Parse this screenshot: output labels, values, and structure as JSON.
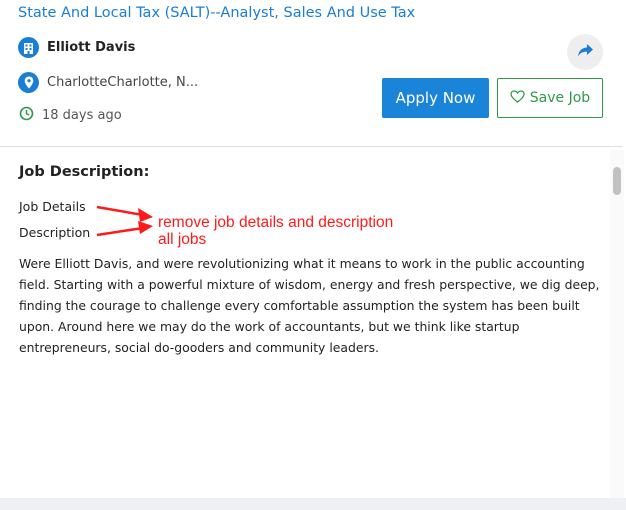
{
  "job": {
    "title": "State And Local Tax (SALT)--Analyst, Sales And Use Tax",
    "company": "Elliott Davis",
    "location": "CharlotteCharlotte, N...",
    "posted": "18 days ago"
  },
  "actions": {
    "apply_label": "Apply Now",
    "save_label": "Save Job"
  },
  "description": {
    "heading": "Job Description:",
    "job_details_label": "Job Details",
    "description_label": "Description",
    "paragraph": "Were Elliott Davis, and were revolutionizing what it means to work in the public accounting field. Starting with a powerful mixture of wisdom, energy and fresh perspective, we dig deep, finding the courage to challenge every comfortable assumption the system has been built upon. Around here we may do the work of accountants, but we think like startup entrepreneurs, social do-gooders and community leaders."
  },
  "annotation": {
    "line1": "remove job details and description",
    "line2": "all jobs",
    "color": "#ff1a1a"
  },
  "colors": {
    "primary": "#1a84d8",
    "save_green": "#2e9a49",
    "title_blue": "#1a7dd6"
  },
  "icons": [
    "building-icon",
    "location-pin-icon",
    "clock-icon",
    "share-arrow-icon",
    "heart-icon"
  ]
}
